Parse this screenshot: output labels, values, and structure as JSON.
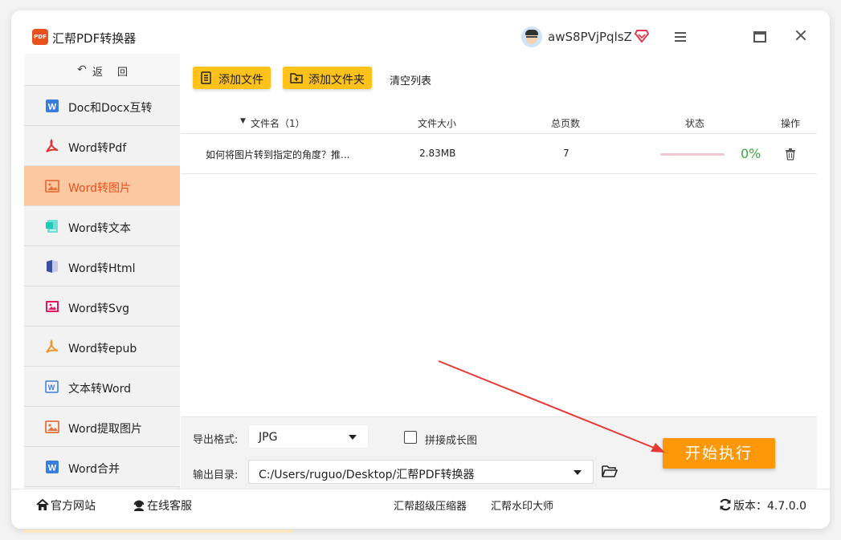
{
  "app": {
    "logo_text": "PDF",
    "title": "汇帮PDF转换器",
    "username": "awS8PVjPqlsZ"
  },
  "sidebar": {
    "back_label": "返回",
    "items": [
      {
        "label": "Doc和Docx互转",
        "icon": "word-icon",
        "active": false
      },
      {
        "label": "Word转Pdf",
        "icon": "pdf-icon",
        "active": false
      },
      {
        "label": "Word转图片",
        "icon": "image-icon",
        "active": true
      },
      {
        "label": "Word转文本",
        "icon": "text-doc-icon",
        "active": false
      },
      {
        "label": "Word转Html",
        "icon": "html-icon",
        "active": false
      },
      {
        "label": "Word转Svg",
        "icon": "svg-image-icon",
        "active": false
      },
      {
        "label": "Word转epub",
        "icon": "epub-icon",
        "active": false
      },
      {
        "label": "文本转Word",
        "icon": "word-outline-icon",
        "active": false
      },
      {
        "label": "Word提取图片",
        "icon": "image-icon",
        "active": false
      },
      {
        "label": "Word合并",
        "icon": "word-icon",
        "active": false
      }
    ]
  },
  "toolbar": {
    "add_file": "添加文件",
    "add_folder": "添加文件夹",
    "clear_list": "清空列表"
  },
  "table": {
    "headers": {
      "filename": "文件名（1）",
      "size": "文件大小",
      "pages": "总页数",
      "status": "状态",
      "actions": "操作"
    },
    "rows": [
      {
        "filename": "如何将图片转到指定的角度？推...",
        "size": "2.83MB",
        "pages": "7",
        "progress_text": "0%",
        "progress": 0
      }
    ]
  },
  "settings": {
    "format_label": "导出格式:",
    "format_value": "JPG",
    "long_image_label": "拼接成长图",
    "long_image_checked": false,
    "output_label": "输出目录:",
    "output_value": "C:/Users/ruguo/Desktop/汇帮PDF转换器",
    "start_label": "开始执行"
  },
  "footer": {
    "website": "官方网站",
    "support": "在线客服",
    "compressor": "汇帮超级压缩器",
    "watermark": "汇帮水印大师",
    "version": "版本：4.7.0.0"
  },
  "colors": {
    "accent": "#ffc21a",
    "start_button": "#ff9808",
    "active_nav": "#fbc8a1",
    "active_text": "#e8501e",
    "progress_text": "#3bab3b",
    "arrow": "#e53935"
  }
}
